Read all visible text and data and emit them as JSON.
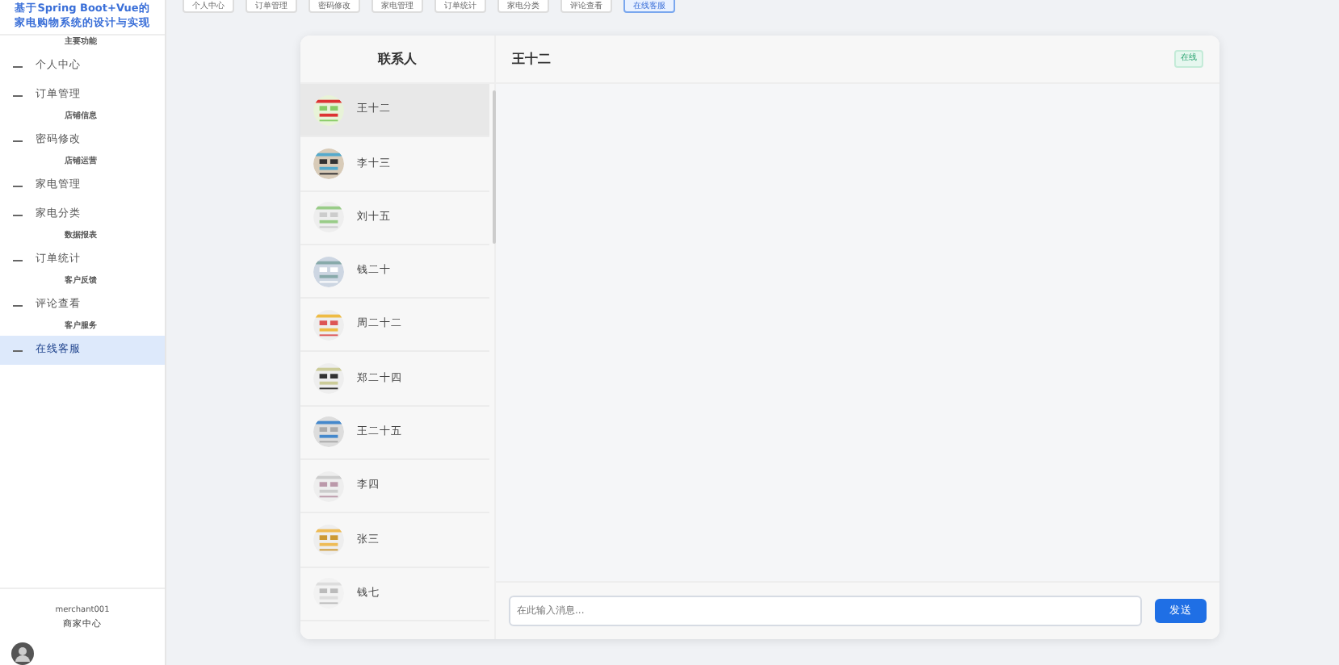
{
  "sidebar": {
    "title_lines": [
      "基于Spring Boot+Vue的",
      "家电购物系统的设计与实现"
    ],
    "items": [
      {
        "label": "主要功能",
        "kind": "caption"
      },
      {
        "label": "个人中心",
        "kind": "item",
        "selected": false
      },
      {
        "label": "订单管理",
        "kind": "item",
        "selected": false
      },
      {
        "label": "店铺信息",
        "kind": "caption"
      },
      {
        "label": "密码修改",
        "kind": "item",
        "selected": false
      },
      {
        "label": "店铺运营",
        "kind": "caption"
      },
      {
        "label": "家电管理",
        "kind": "item",
        "selected": false
      },
      {
        "label": "家电分类",
        "kind": "item",
        "selected": false
      },
      {
        "label": "数据报表",
        "kind": "caption"
      },
      {
        "label": "订单统计",
        "kind": "item",
        "selected": false
      },
      {
        "label": "客户反馈",
        "kind": "caption"
      },
      {
        "label": "评论查看",
        "kind": "item",
        "selected": false
      },
      {
        "label": "客户服务",
        "kind": "caption"
      },
      {
        "label": "在线客服",
        "kind": "item",
        "selected": true
      }
    ],
    "user": {
      "name": "merchant001",
      "role": "商家中心"
    }
  },
  "tabs": [
    {
      "label": "个人中心",
      "selected": false
    },
    {
      "label": "订单管理",
      "selected": false
    },
    {
      "label": "密码修改",
      "selected": false
    },
    {
      "label": "家电管理",
      "selected": false
    },
    {
      "label": "订单统计",
      "selected": false
    },
    {
      "label": "家电分类",
      "selected": false
    },
    {
      "label": "评论查看",
      "selected": false
    },
    {
      "label": "在线客服",
      "selected": true
    }
  ],
  "contacts": {
    "title": "联系人",
    "items": [
      {
        "name": "王十二",
        "selected": true
      },
      {
        "name": "李十三",
        "selected": false
      },
      {
        "name": "刘十五",
        "selected": false
      },
      {
        "name": "钱二十",
        "selected": false
      },
      {
        "name": "周二十二",
        "selected": false
      },
      {
        "name": "郑二十四",
        "selected": false
      },
      {
        "name": "王二十五",
        "selected": false
      },
      {
        "name": "李四",
        "selected": false
      },
      {
        "name": "张三",
        "selected": false
      },
      {
        "name": "钱七",
        "selected": false
      }
    ]
  },
  "chat": {
    "name": "王十二",
    "status": "在线",
    "placeholder": "在此输入消息...",
    "send": "发送"
  }
}
